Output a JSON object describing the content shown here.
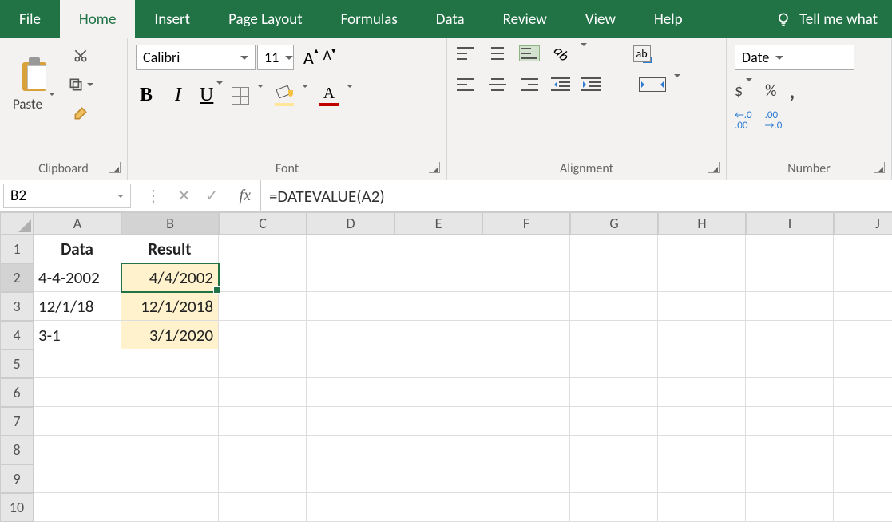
{
  "tabs": {
    "file": "File",
    "home": "Home",
    "insert": "Insert",
    "page_layout": "Page Layout",
    "formulas": "Formulas",
    "data": "Data",
    "review": "Review",
    "view": "View",
    "help": "Help",
    "tellme": "Tell me what"
  },
  "ribbon": {
    "clipboard": {
      "paste": "Paste",
      "label": "Clipboard"
    },
    "font": {
      "name": "Calibri",
      "size": "11",
      "bold": "B",
      "italic": "I",
      "underline": "U",
      "grow": "A",
      "shrink": "A",
      "fontcolor_letter": "A",
      "label": "Font"
    },
    "alignment": {
      "orient": "ab",
      "wrap": "ab",
      "label": "Alignment"
    },
    "number": {
      "format": "Date",
      "currency": "$",
      "percent": "%",
      "comma": ",",
      "dec_inc": "←.0\n.00",
      "dec_dec": ".00\n→.0",
      "label": "Number"
    }
  },
  "formula_bar": {
    "namebox": "B2",
    "cancel": "✕",
    "enter": "✓",
    "fx": "fx",
    "formula": "=DATEVALUE(A2)"
  },
  "grid": {
    "columns": [
      "A",
      "B",
      "C",
      "D",
      "E",
      "F",
      "G",
      "H",
      "I",
      "J"
    ],
    "rows": [
      "1",
      "2",
      "3",
      "4",
      "5",
      "6",
      "7",
      "8",
      "9",
      "10"
    ],
    "headers": {
      "A1": "Data",
      "B1": "Result"
    },
    "data": {
      "A2": "4-4-2002",
      "B2": "4/4/2002",
      "A3": "12/1/18",
      "B3": "12/1/2018",
      "A4": "3-1",
      "B4": "3/1/2020"
    }
  }
}
